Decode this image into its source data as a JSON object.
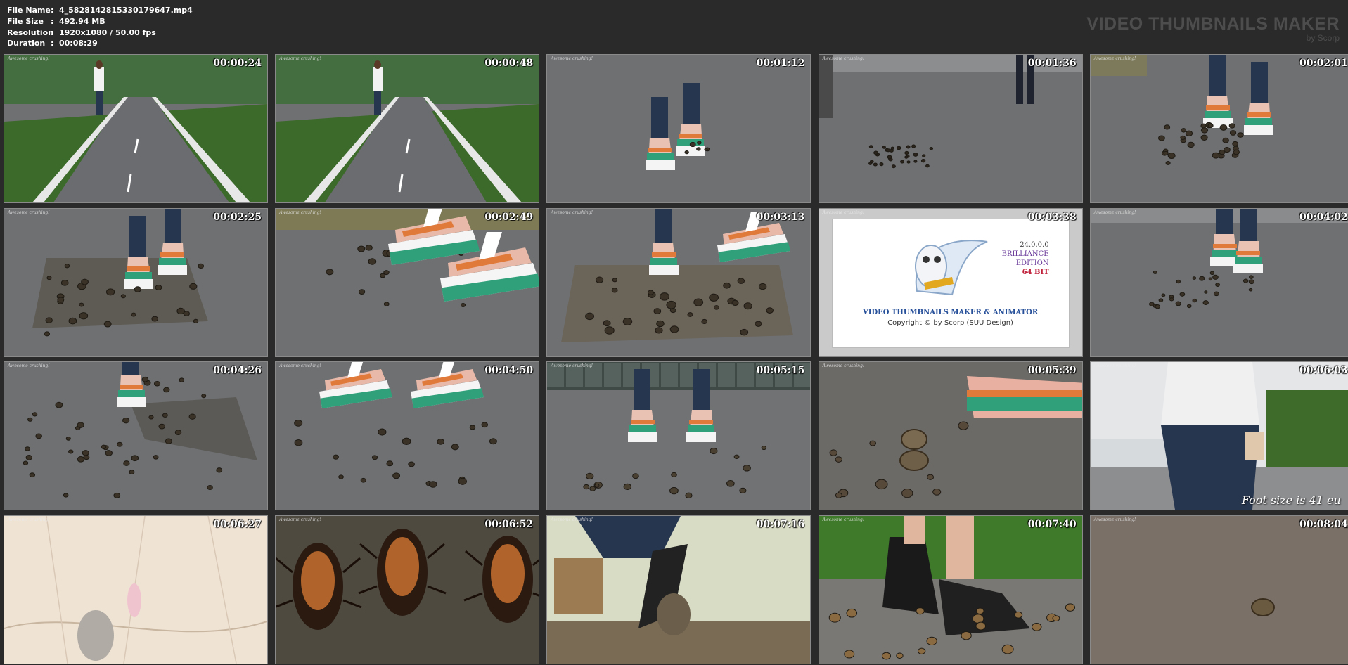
{
  "file_info": {
    "name": {
      "label": "File Name",
      "value": "4_5828142815330179647.mp4"
    },
    "size": {
      "label": "File Size",
      "value": "492.94 MB"
    },
    "resolution": {
      "label": "Resolution",
      "value": "1920x1080 / 50.00 fps"
    },
    "duration": {
      "label": "Duration",
      "value": "00:08:29"
    },
    "separator": ":"
  },
  "brand": {
    "title": "VIDEO THUMBNAILS MAKER",
    "subtitle": "by Scorp"
  },
  "watermark": "Awesome crushing!",
  "thumbnails": [
    {
      "time": "00:00:24",
      "scene": "park-road-walk"
    },
    {
      "time": "00:00:48",
      "scene": "park-road-walk-close"
    },
    {
      "time": "00:01:12",
      "scene": "sandals-asphalt"
    },
    {
      "time": "00:01:36",
      "scene": "snails-on-asphalt-far"
    },
    {
      "time": "00:02:01",
      "scene": "snails-sandals"
    },
    {
      "time": "00:02:25",
      "scene": "crushing-sandals"
    },
    {
      "time": "00:02:49",
      "scene": "wedge-close"
    },
    {
      "time": "00:03:13",
      "scene": "crushing-mess"
    },
    {
      "time": "00:03:38",
      "scene": "software-splash"
    },
    {
      "time": "00:04:02",
      "scene": "snails-sandals-far"
    },
    {
      "time": "00:04:26",
      "scene": "snails-scattered"
    },
    {
      "time": "00:04:50",
      "scene": "wedge-snails"
    },
    {
      "time": "00:05:15",
      "scene": "wall-tiles-sandals"
    },
    {
      "time": "00:05:39",
      "scene": "snails-closeup"
    },
    {
      "time": "00:06:03",
      "scene": "jeans-walking",
      "caption": "Foot size is 41 eu"
    },
    {
      "time": "00:06:27",
      "scene": "bright-dry-ground"
    },
    {
      "time": "00:06:52",
      "scene": "cockroaches"
    },
    {
      "time": "00:07:16",
      "scene": "shoe-crush-room"
    },
    {
      "time": "00:07:40",
      "scene": "black-loafers-snails"
    },
    {
      "time": "00:08:04",
      "scene": "single-snail"
    }
  ],
  "splash": {
    "version": "24.0.0.0",
    "edition1": "BRILLIANCE",
    "edition2": "EDITION",
    "bits": "64 BIT",
    "product": "VIDEO THUMBNAILS MAKER & ANIMATOR",
    "copyright": "Copyright © by Scorp (SUU Design)",
    "icon": "owl-mascot-icon"
  },
  "colors": {
    "background": "#2a2a2a",
    "brand_text": "#4d4d4d",
    "asphalt": "#6f7072",
    "grass": "#3c6a2a",
    "denim": "#27364f",
    "sandal_green": "#2fa07a",
    "sandal_orange": "#e07a3a"
  }
}
